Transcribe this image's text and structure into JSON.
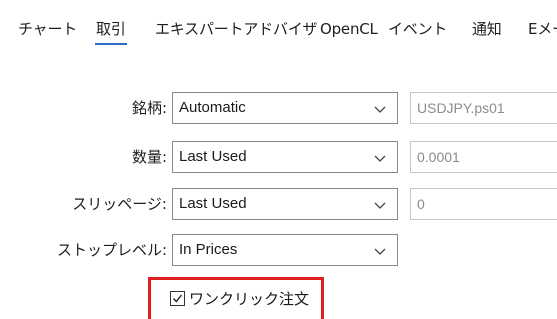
{
  "tabs": [
    {
      "label": "チャート"
    },
    {
      "label": "取引",
      "active": true
    },
    {
      "label": "エキスパートアドバイザ"
    },
    {
      "label": "OpenCL"
    },
    {
      "label": "イベント"
    },
    {
      "label": "通知"
    },
    {
      "label": "Eメー"
    }
  ],
  "form": {
    "symbol": {
      "label": "銘柄:",
      "select_value": "Automatic",
      "field_value": "USDJPY.ps01"
    },
    "volume": {
      "label": "数量:",
      "select_value": "Last Used",
      "field_value": "0.0001"
    },
    "slippage": {
      "label": "スリッページ:",
      "select_value": "Last Used",
      "field_value": "0"
    },
    "stop_level": {
      "label": "ストップレベル:",
      "select_value": "In Prices"
    }
  },
  "one_click": {
    "label": "ワンクリック注文",
    "checked": true
  },
  "colors": {
    "accent": "#2a6ac8",
    "highlight": "#e02020"
  }
}
